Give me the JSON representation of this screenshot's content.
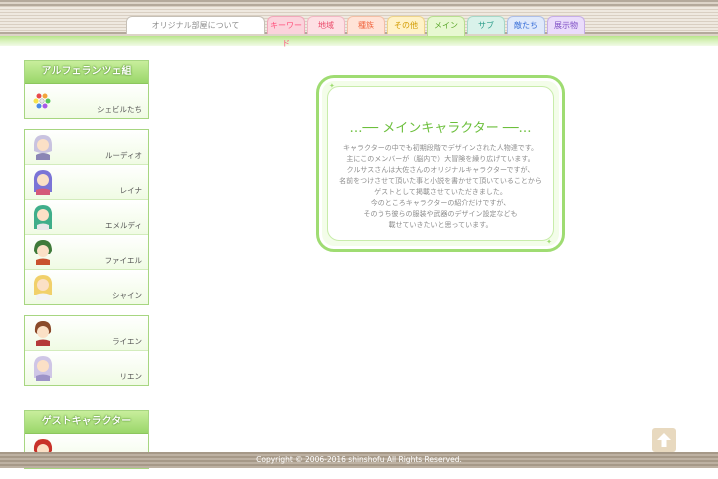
{
  "tabs": [
    {
      "label": "オリジナル部屋について"
    },
    {
      "label": "キーワード"
    },
    {
      "label": "地域"
    },
    {
      "label": "種族"
    },
    {
      "label": "その他"
    },
    {
      "label": "メイン"
    },
    {
      "label": "サブ"
    },
    {
      "label": "敵たち"
    },
    {
      "label": "展示物"
    }
  ],
  "sidebar": {
    "groups": [
      {
        "title": "アルフェランツェ組",
        "items": [
          {
            "label": "シェビルたち"
          }
        ]
      },
      {
        "title": "",
        "items": [
          {
            "label": "ルーディオ"
          },
          {
            "label": "レイナ"
          },
          {
            "label": "エメルディ"
          },
          {
            "label": "ファイエル"
          },
          {
            "label": "シャイン"
          }
        ]
      },
      {
        "title": "",
        "items": [
          {
            "label": "ライエン"
          },
          {
            "label": "リエン"
          }
        ]
      },
      {
        "title": "ゲストキャラクター",
        "items": [
          {
            "label": ""
          }
        ]
      }
    ]
  },
  "main": {
    "title": "…── メインキャラクター ──…",
    "lines": [
      "キャラクターの中でも初期段階でデザインされた人物達です。",
      "主にこのメンバーが（脳内で）大冒険を繰り広げています。",
      "クルサスさんは大佐さんのオリジナルキャラクターですが、",
      "名前をつけさせて頂いた事と小説を書かせて頂いていることから",
      "ゲストとして掲載させていただきました。",
      "今のところキャラクターの紹介だけですが、",
      "そのうち彼らの服装や武器のデザイン設定なども",
      "載せていきたいと思っています。"
    ]
  },
  "footer": {
    "copyright": "Copyright © 2006-2016 shinshofu All Rights Reserved."
  },
  "icons": {
    "to_top": "arrow-up-icon"
  },
  "colors": {
    "accent_green": "#9fdc72",
    "title_green": "#6cbf3c"
  }
}
